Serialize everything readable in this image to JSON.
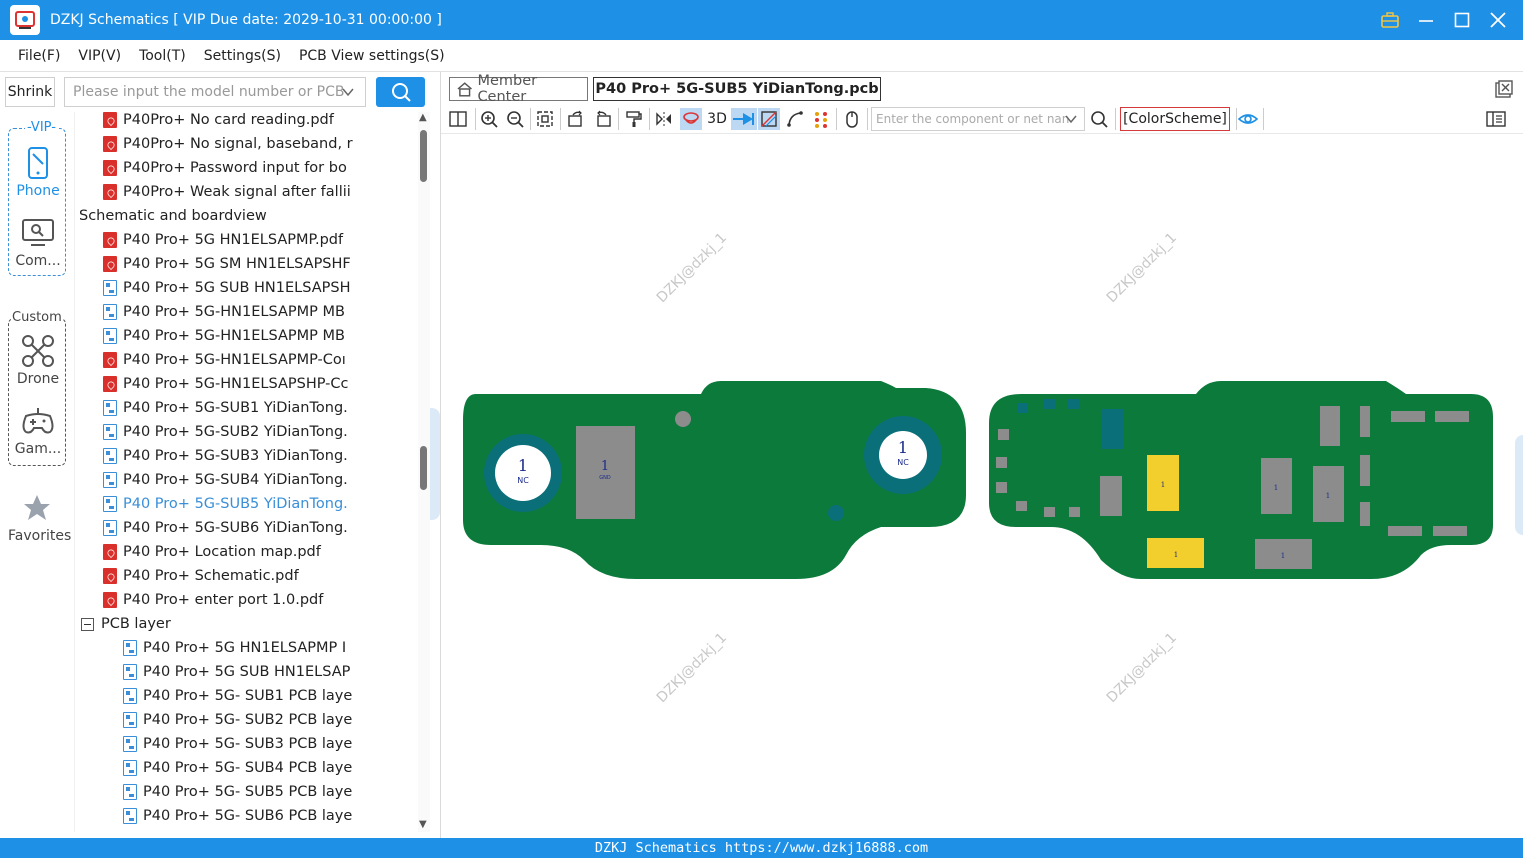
{
  "window": {
    "title": "DZKJ Schematics [ VIP Due date: 2029-10-31 00:00:00 ]",
    "accent": "#1e90e6"
  },
  "menu": [
    "File(F)",
    "VIP(V)",
    "Tool(T)",
    "Settings(S)",
    "PCB View settings(S)"
  ],
  "search": {
    "shrink_label": "Shrink",
    "placeholder": "Please input the model number or PCB"
  },
  "rail": {
    "vip_label": "-VIP-",
    "custom_label": "Custom",
    "items": {
      "phone": "Phone",
      "computer": "Com...",
      "drone": "Drone",
      "game": "Gam...",
      "favorites": "Favorites"
    }
  },
  "tree": {
    "rows": [
      {
        "icon": "pdf",
        "label": "P40Pro+ No card reading.pdf",
        "level": 2
      },
      {
        "icon": "pdf",
        "label": "P40Pro+ No signal, baseband, r",
        "level": 2
      },
      {
        "icon": "pdf",
        "label": "P40Pro+ Password input for bo",
        "level": 2
      },
      {
        "icon": "pdf",
        "label": "P40Pro+ Weak signal after fallii",
        "level": 2
      },
      {
        "icon": "folder",
        "label": "Schematic and boardview",
        "level": 1
      },
      {
        "icon": "pdf",
        "label": "P40 Pro+ 5G HN1ELSAPMP.pdf",
        "level": 2
      },
      {
        "icon": "pdf",
        "label": "P40 Pro+ 5G SM HN1ELSAPSHF",
        "level": 2
      },
      {
        "icon": "pcb",
        "label": "P40 Pro+ 5G SUB HN1ELSAPSH",
        "level": 2
      },
      {
        "icon": "pcb",
        "label": "P40 Pro+ 5G-HN1ELSAPMP MB",
        "level": 2
      },
      {
        "icon": "pcb",
        "label": "P40 Pro+ 5G-HN1ELSAPMP MB",
        "level": 2
      },
      {
        "icon": "pdf",
        "label": "P40 Pro+ 5G-HN1ELSAPMP-Coı",
        "level": 2
      },
      {
        "icon": "pdf",
        "label": "P40 Pro+ 5G-HN1ELSAPSHP-Cc",
        "level": 2
      },
      {
        "icon": "pcb",
        "label": "P40 Pro+ 5G-SUB1 YiDianTong.",
        "level": 2
      },
      {
        "icon": "pcb",
        "label": "P40 Pro+ 5G-SUB2 YiDianTong.",
        "level": 2
      },
      {
        "icon": "pcb",
        "label": "P40 Pro+ 5G-SUB3 YiDianTong.",
        "level": 2
      },
      {
        "icon": "pcb",
        "label": "P40 Pro+ 5G-SUB4 YiDianTong.",
        "level": 2
      },
      {
        "icon": "pcb",
        "label": "P40 Pro+ 5G-SUB5 YiDianTong.",
        "level": 2,
        "selected": true
      },
      {
        "icon": "pcb",
        "label": "P40 Pro+ 5G-SUB6 YiDianTong.",
        "level": 2
      },
      {
        "icon": "pdf",
        "label": "P40 Pro+ Location map.pdf",
        "level": 2
      },
      {
        "icon": "pdf",
        "label": "P40 Pro+ Schematic.pdf",
        "level": 2
      },
      {
        "icon": "pdf",
        "label": "P40 Pro+ enter port 1.0.pdf",
        "level": 2
      },
      {
        "icon": "folder",
        "label": "PCB layer",
        "level": 2
      },
      {
        "icon": "pcb",
        "label": "P40 Pro+ 5G HN1ELSAPMP I",
        "level": 3
      },
      {
        "icon": "pcb",
        "label": "P40 Pro+ 5G SUB HN1ELSAP",
        "level": 3
      },
      {
        "icon": "pcb",
        "label": "P40 Pro+ 5G- SUB1 PCB laye",
        "level": 3
      },
      {
        "icon": "pcb",
        "label": "P40 Pro+ 5G- SUB2 PCB laye",
        "level": 3
      },
      {
        "icon": "pcb",
        "label": "P40 Pro+ 5G- SUB3 PCB laye",
        "level": 3
      },
      {
        "icon": "pcb",
        "label": "P40 Pro+ 5G- SUB4 PCB laye",
        "level": 3
      },
      {
        "icon": "pcb",
        "label": "P40 Pro+ 5G- SUB5 PCB laye",
        "level": 3
      },
      {
        "icon": "pcb",
        "label": "P40 Pro+ 5G- SUB6 PCB laye",
        "level": 3
      }
    ]
  },
  "tabs": {
    "member": "Member Center",
    "active": "P40 Pro+ 5G-SUB5 YiDianTong.pcb"
  },
  "toolbar": {
    "label_3d": "3D",
    "component_placeholder": "Enter the component or net nan",
    "color_scheme": "[ColorScheme]"
  },
  "canvas": {
    "watermark": "DZKJ@dzkj_1",
    "board_color": "#0b7a3a",
    "labels": {
      "pin1": "1",
      "nc": "NC",
      "gnd": "GND"
    }
  },
  "footer": {
    "text": "DZKJ Schematics https://www.dzkj16888.com"
  }
}
